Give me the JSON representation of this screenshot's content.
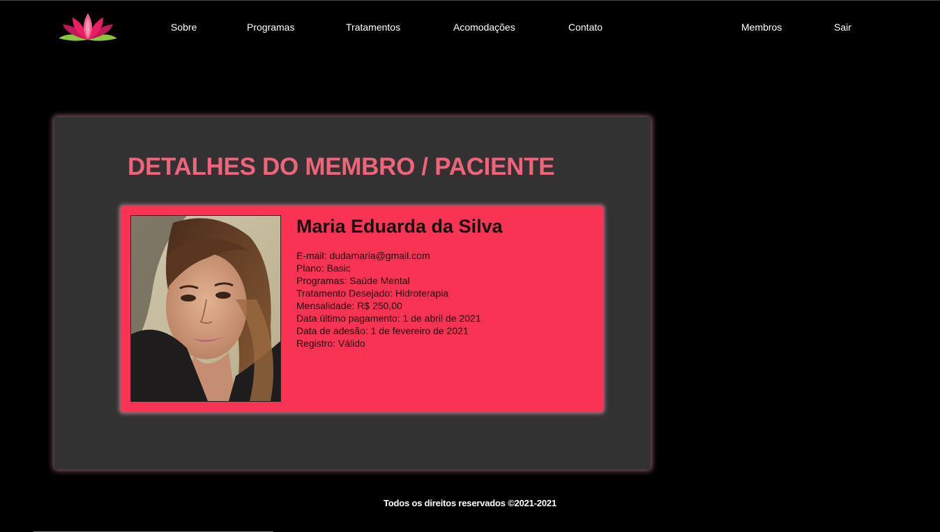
{
  "nav": {
    "logo_icon": "lotus-logo-icon",
    "links": [
      {
        "label": "Sobre"
      },
      {
        "label": "Programas"
      },
      {
        "label": "Tratamentos"
      },
      {
        "label": "Acomodações"
      },
      {
        "label": "Contato"
      },
      {
        "label": "Membros"
      },
      {
        "label": "Sair"
      }
    ]
  },
  "main": {
    "title": "DETALHES DO MEMBRO / PACIENTE",
    "member": {
      "photo_icon": "member-photo",
      "name": "Maria Eduarda da Silva",
      "details": [
        "E-mail: dudamaria@gmail.com",
        "Plano: Basic",
        "Programas: Saúde Mental",
        "Tratamento Desejado: Hidroterapia",
        "Mensalidade: R$ 250,00",
        "Data último pagamento: 1 de abril de 2021",
        "Data de adesão: 1 de fevereiro de 2021",
        "Registro: Válido"
      ]
    }
  },
  "footer": {
    "text": "Todos os direitos reservados ©2021-2021"
  },
  "colors": {
    "background": "#000000",
    "panel": "#333233",
    "accent_title": "#f0647b",
    "card": "#f83353"
  }
}
